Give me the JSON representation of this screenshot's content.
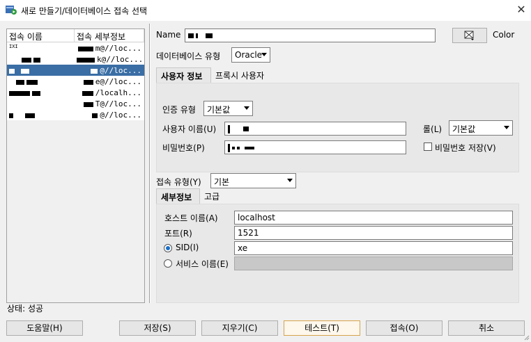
{
  "window": {
    "title": "새로 만들기/데이터베이스 접속 선택",
    "close_glyph": "✕"
  },
  "connections": {
    "columns": [
      "접속 이름",
      "접속 세부정보"
    ],
    "rows": [
      {
        "name": "IXI",
        "details": "m@//loc...",
        "selected": false
      },
      {
        "name": "",
        "details": "k@//loc...",
        "selected": false
      },
      {
        "name": "",
        "details": "@//loc...",
        "selected": true
      },
      {
        "name": "",
        "details": "e@//loc...",
        "selected": false
      },
      {
        "name": "",
        "details": "/localh...",
        "selected": false
      },
      {
        "name": "",
        "details": "T@//loc...",
        "selected": false
      },
      {
        "name": "",
        "details": "@//loc...",
        "selected": false
      }
    ]
  },
  "form": {
    "name_label": "Name",
    "color_label": "Color",
    "db_type_label": "데이터베이스 유형",
    "db_type_value": "Oracle",
    "tabs": [
      "사용자 정보",
      "프록시 사용자"
    ],
    "auth_type_label": "인증 유형",
    "auth_type_value": "기본값",
    "username_label": "사용자 이름(U)",
    "role_label": "롤(L)",
    "role_value": "기본값",
    "password_label": "비밀번호(P)",
    "save_password_label": "비밀번호 저장(V)",
    "conn_type_label": "접속 유형(Y)",
    "conn_type_value": "기본",
    "detail_tabs": [
      "세부정보",
      "고급"
    ],
    "host_label": "호스트 이름(A)",
    "host_value": "localhost",
    "port_label": "포트(R)",
    "port_value": "1521",
    "sid_label": "SID(I)",
    "sid_value": "xe",
    "service_label": "서비스 이름(E)",
    "service_value": ""
  },
  "status": "상태: 성공",
  "buttons": {
    "help": "도움말(H)",
    "save": "저장(S)",
    "clear": "지우기(C)",
    "test": "테스트(T)",
    "connect": "접속(O)",
    "cancel": "취소"
  },
  "colors": {
    "selection": "#3a6ea5",
    "radio_on": "#1a6fc8",
    "focus_border": "#d6a44a"
  }
}
